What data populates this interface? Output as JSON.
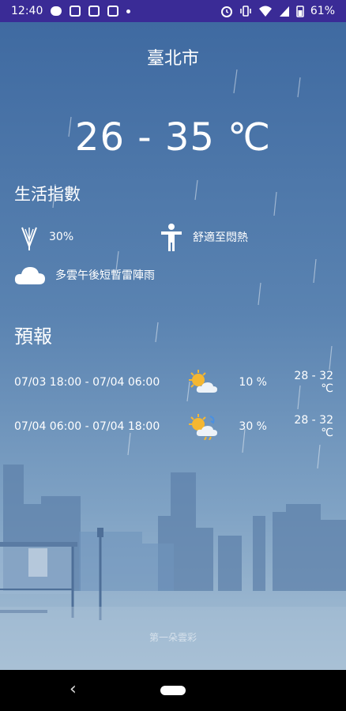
{
  "status_bar": {
    "time": "12:40",
    "battery": "61%",
    "icons": [
      "chat-bubble-icon",
      "calendar-icon",
      "calendar-icon",
      "calendar-icon",
      "dot-icon",
      "alarm-icon",
      "vibrate-icon",
      "wifi-icon",
      "signal-icon",
      "battery-icon"
    ]
  },
  "location": {
    "city": "臺北市"
  },
  "current": {
    "temp_range": "26 - 35 ℃"
  },
  "life_index": {
    "title": "生活指數",
    "rain_chance": "30%",
    "comfort": "舒適至悶熱",
    "description": "多雲午後短暫雷陣雨"
  },
  "forecast": {
    "title": "預報",
    "rows": [
      {
        "time": "07/03 18:00 - 07/04 06:00",
        "icon": "sun-cloud-icon",
        "prob": "10 %",
        "range": "28 - 32 ℃"
      },
      {
        "time": "07/04 06:00 - 07/04 18:00",
        "icon": "sun-cloud-rain-icon",
        "prob": "30 %",
        "range": "28 - 32 ℃"
      }
    ]
  },
  "attribution": "第一朵雲彩",
  "colors": {
    "status_bar": "#3a2b96",
    "sky_top": "#3f6aa1",
    "sky_bottom": "#a9c1d5",
    "sun": "#f5b731"
  }
}
